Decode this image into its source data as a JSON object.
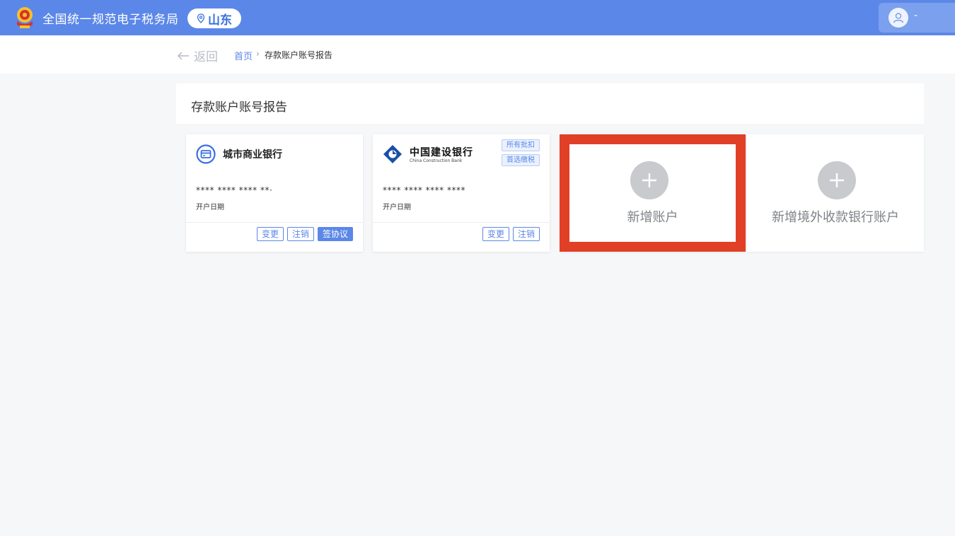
{
  "header": {
    "site_title": "全国统一规范电子税务局",
    "region": "山东",
    "user_name": "-"
  },
  "breadcrumb": {
    "back_label": "返回",
    "home": "首页",
    "separator": "›",
    "current": "存款账户账号报告"
  },
  "section": {
    "title": "存款账户账号报告"
  },
  "accounts": [
    {
      "bank_name": "城市商业银行",
      "account_number": "**** **** **** **·",
      "open_date_label": "开户日期",
      "actions": [
        "变更",
        "注销",
        "签协议"
      ]
    },
    {
      "bank_name": "中国建设银行",
      "bank_name_en": "China Construction Bank",
      "tags": [
        "所有批扣",
        "首选缴税"
      ],
      "account_number": "**** **** **** ****",
      "open_date_label": "开户日期",
      "actions": [
        "变更",
        "注销"
      ]
    }
  ],
  "add_cards": {
    "add_account": "新增账户",
    "add_foreign_account": "新增境外收款银行账户"
  },
  "colors": {
    "header_bg": "#5b87e8",
    "accent": "#5b87e8",
    "highlight_border": "#e14027",
    "page_bg": "#f6f7f9"
  }
}
